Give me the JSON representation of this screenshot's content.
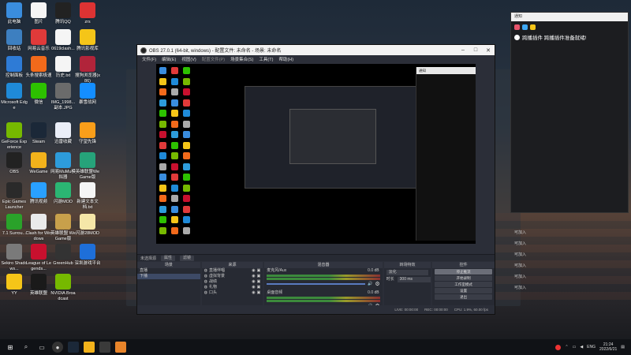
{
  "desktop_icons": [
    {
      "label": "此电脑",
      "color": "#3a8dde"
    },
    {
      "label": "图片",
      "color": "#f5f5f5"
    },
    {
      "label": "腾讯QQ",
      "color": "#222"
    },
    {
      "label": "zrs",
      "color": "#d33"
    },
    {
      "label": "回收站",
      "color": "#3d7fc0"
    },
    {
      "label": "网易云音乐",
      "color": "#e03a3a"
    },
    {
      "label": "0619clash...",
      "color": "#f5f5f5"
    },
    {
      "label": "腾讯影视库",
      "color": "#f5c518"
    },
    {
      "label": "控制面板",
      "color": "#2e7bd6"
    },
    {
      "label": "头条搜索极速",
      "color": "#f26a1b"
    },
    {
      "label": "历史.txt",
      "color": "#f5f5f5"
    },
    {
      "label": "搜狗浏览器(x86)",
      "color": "#b1243a"
    },
    {
      "label": "Microsoft Edge",
      "color": "#1f8ad8"
    },
    {
      "label": "微信",
      "color": "#2dc100"
    },
    {
      "label": "IMG_1998...副本.JPG",
      "color": "#6b6b6b"
    },
    {
      "label": "暴雪战网",
      "color": "#148eff"
    },
    {
      "label": "GeForce Experience",
      "color": "#76b900"
    },
    {
      "label": "Steam",
      "color": "#1b2838"
    },
    {
      "label": "迅雷收藏",
      "color": "#eaeef8"
    },
    {
      "label": "守望先锋",
      "color": "#f99e1a"
    },
    {
      "label": "OBS",
      "color": "#222"
    },
    {
      "label": "WeGame",
      "color": "#f2b21b"
    },
    {
      "label": "网易MuMu模拟器",
      "color": "#2d9cdb"
    },
    {
      "label": "英雄联盟WeGame版",
      "color": "#26a37a"
    },
    {
      "label": "Epic Games Launcher",
      "color": "#2a2a2a"
    },
    {
      "label": "腾讯视频",
      "color": "#29a0ff"
    },
    {
      "label": "闪游MOD",
      "color": "#2bb673"
    },
    {
      "label": "新建文本文档.txt",
      "color": "#f5f5f5"
    },
    {
      "label": "7.1 Surrou...",
      "color": "#2aa22a"
    },
    {
      "label": "Clash for Windows",
      "color": "#eaeaea"
    },
    {
      "label": "英雄联盟 WeGame版",
      "color": "#c8a04b"
    },
    {
      "label": "闪游28MOD",
      "color": "#f5e7a8"
    },
    {
      "label": "Sekiro Shadows...",
      "color": "#7a7a7a"
    },
    {
      "label": "League of Legends...",
      "color": "#c8102e"
    },
    {
      "label": "GreenHub",
      "color": "#333"
    },
    {
      "label": "深圳游戏平台",
      "color": "#1e6fd9"
    },
    {
      "label": "YY",
      "color": "#f5c518"
    },
    {
      "label": "英雄联盟",
      "color": "#1a1a1a"
    },
    {
      "label": "NVIDIA Broadcast",
      "color": "#76b900"
    }
  ],
  "obs": {
    "title": "OBS 27.0.1 (64-bit, windows) - 配置文件: 未命名 - 场景: 未命名",
    "menu": [
      "文件(F)",
      "编辑(E)",
      "视图(V)",
      "配置文件(P)",
      "场景集合(S)",
      "工具(T)",
      "帮助(H)"
    ],
    "menu_dim_index": 3,
    "toolbar": {
      "label": "未选择源",
      "properties": "属性",
      "filters": "滤镜"
    },
    "docks": {
      "scenes": {
        "header": "场景",
        "items": [
          "直播",
          "下播"
        ],
        "selected": 1
      },
      "sources": {
        "header": "来源",
        "items": [
          "直播伴唱",
          "虚拟背景",
          "战绩",
          "礼物",
          "口头"
        ]
      },
      "mixer": {
        "header": "混音器",
        "channels": [
          {
            "name": "麦克风/Aux",
            "db": "0.0 dB"
          },
          {
            "name": "桌面音频",
            "db": "0.0 dB"
          }
        ]
      },
      "transitions": {
        "header": "转场特效",
        "type": "淡化",
        "duration_label": "时长",
        "duration": "300 ms"
      },
      "controls": {
        "header": "控件",
        "buttons": [
          "停止推流",
          "开始录制",
          "工作室模式",
          "设置",
          "退出"
        ],
        "active_index": 0
      }
    },
    "status": {
      "live_label": "LIVE:",
      "live_time": "00:00:00",
      "rec_label": "REC:",
      "rec_time": "00:00:00",
      "cpu": "CPU: 1.9%, 60.00 fps"
    }
  },
  "notify_panel": {
    "title": "通知",
    "message": "跨播插件 跨播插件准备就绪!"
  },
  "right_list": [
    "可加入",
    "可加入",
    "可加入",
    "可加入",
    "可加入",
    "可加入"
  ],
  "taskbar": {
    "lang": "ENG",
    "time": "21:24",
    "date": "2022/6/21"
  }
}
